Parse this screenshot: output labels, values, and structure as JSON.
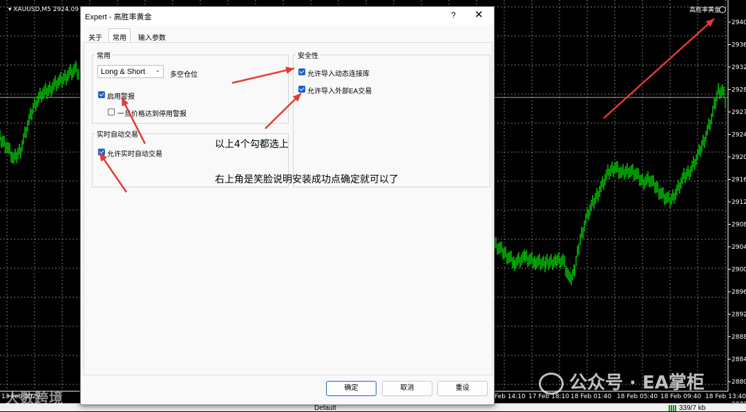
{
  "chart": {
    "symbol_label": "XAUUSD,M5  2924.09 2927...",
    "ea_label": "高胜率黄金",
    "price_ticks": [
      "2940.",
      "2936.",
      "2932.",
      "2928.",
      "2927.",
      "2924.",
      "2920.",
      "2916.",
      "2912.",
      "2908.",
      "2904.",
      "2900.",
      "2896.",
      "2892.",
      "2888.",
      "2884.",
      "2880.",
      "2877."
    ],
    "time_ticks": [
      "13 Feb 2025",
      "Feb 14:10",
      "17 Feb 18:10",
      "18 Feb 01:40",
      "18 Feb 05:40",
      "18 Feb 09:40",
      "18 Feb 13:40"
    ],
    "colors": {
      "background": "#000000",
      "candles": "#00c800",
      "grid": "#7a7a7a",
      "arrows": "#e53935"
    }
  },
  "dialog": {
    "title": "Expert - 高胜率黄金",
    "help_icon": "?",
    "close_icon": "✕",
    "tabs": [
      "关于",
      "常用",
      "输入参数"
    ],
    "active_tab": "常用",
    "groups": {
      "common": "常用",
      "security": "安全性",
      "autotrade": "实时自动交易"
    },
    "mode_select": {
      "value": "Long & Short",
      "label": "多空仓位"
    },
    "checkboxes": {
      "enable_alerts": {
        "label": "启用警报",
        "checked": true
      },
      "stop_alert_once": {
        "label": "一旦价格达到停用警报",
        "checked": false
      },
      "allow_dll": {
        "label": "允许导入动态连接库",
        "checked": true
      },
      "allow_external_ea": {
        "label": "允许导入外部EA交易",
        "checked": true
      },
      "allow_live_trading": {
        "label": "允许实时自动交易",
        "checked": true
      }
    },
    "buttons": {
      "ok": "确定",
      "cancel": "取消",
      "reset": "重设"
    }
  },
  "annotations": {
    "check_all": "以上4个勾都选上",
    "smiley_note": "右上角是笑脸说明安装成功点确定就可以了"
  },
  "status_bar": {
    "profile": "Default",
    "traffic": "339/7 kb"
  },
  "watermarks": {
    "left": "大数跨境",
    "right": "公众号 · EA掌柜"
  }
}
